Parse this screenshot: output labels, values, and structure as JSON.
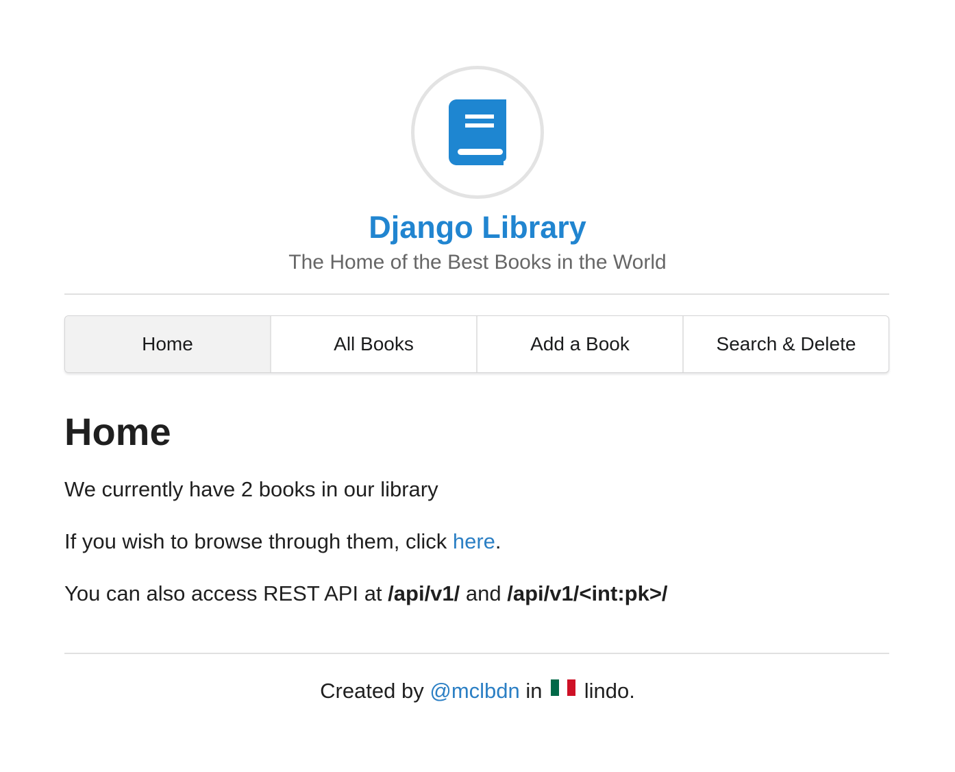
{
  "header": {
    "logo_icon": "book-icon",
    "title": "Django Library",
    "subtitle": "The Home of the Best Books in the World"
  },
  "nav": {
    "items": [
      {
        "label": "Home",
        "active": true
      },
      {
        "label": "All Books",
        "active": false
      },
      {
        "label": "Add a Book",
        "active": false
      },
      {
        "label": "Search & Delete",
        "active": false
      }
    ]
  },
  "main": {
    "heading": "Home",
    "p1": "We currently have 2 books in our library",
    "p2_before": "If you wish to browse through them, click ",
    "p2_link": "here",
    "p2_after": ".",
    "p3_before": "You can also access REST API at ",
    "p3_endpoint1": "/api/v1/",
    "p3_middle": " and ",
    "p3_endpoint2": "/api/v1/<int:pk>/"
  },
  "footer": {
    "before": "Created by ",
    "author_link": "@mclbdn",
    "middle": " in ",
    "flag_icon": "mexico-flag-icon",
    "after": " lindo."
  },
  "colors": {
    "accent": "#2185d0",
    "link": "#2b7fc4",
    "subtitle": "#666666",
    "active_tab_bg": "#f2f2f2"
  }
}
